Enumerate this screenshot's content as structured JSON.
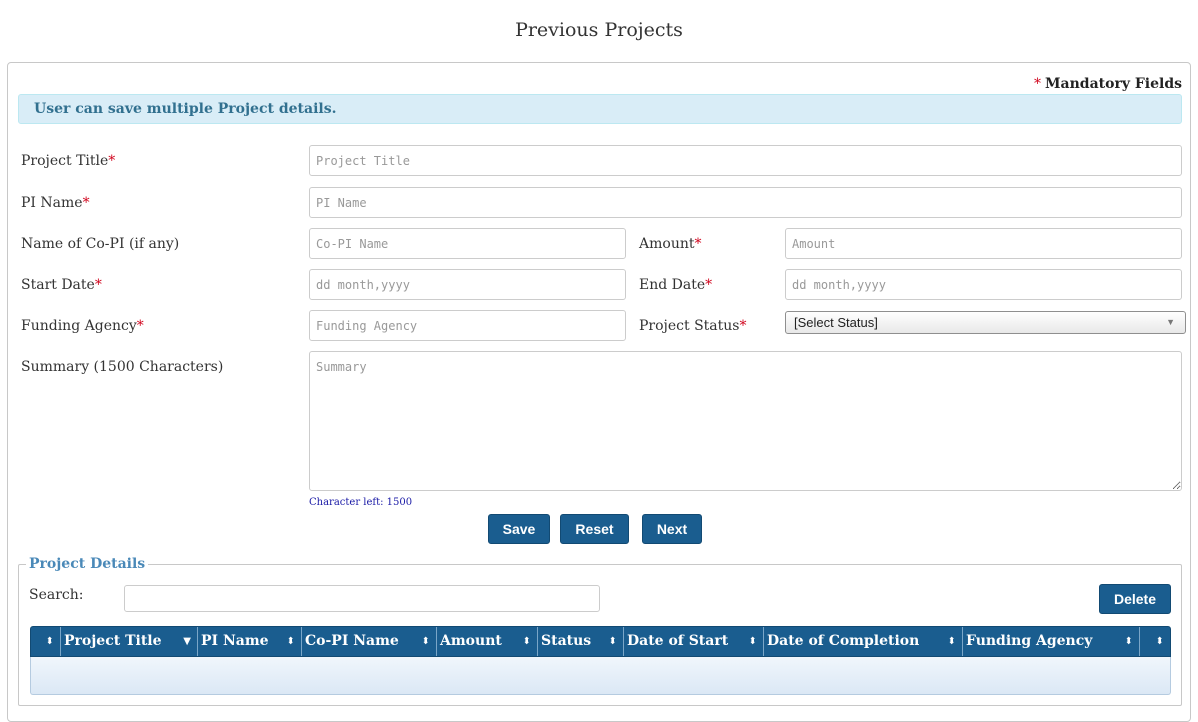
{
  "page": {
    "title": "Previous Projects"
  },
  "form": {
    "mandatory_label": "Mandatory Fields",
    "info_message": "User can save multiple Project details.",
    "fields": {
      "project_title": {
        "label": "Project Title",
        "placeholder": "Project Title"
      },
      "pi_name": {
        "label": "PI Name",
        "placeholder": "PI Name"
      },
      "co_pi": {
        "label": "Name of Co-PI (if any)",
        "placeholder": "Co-PI Name"
      },
      "amount": {
        "label": "Amount",
        "placeholder": "Amount"
      },
      "start_date": {
        "label": "Start Date",
        "placeholder": "dd month,yyyy"
      },
      "end_date": {
        "label": "End Date",
        "placeholder": "dd month,yyyy"
      },
      "funding_agency": {
        "label": "Funding Agency",
        "placeholder": "Funding Agency"
      },
      "project_status": {
        "label": "Project Status",
        "value": "[Select Status]"
      },
      "summary": {
        "label": "Summary (1500 Characters)",
        "placeholder": "Summary"
      }
    },
    "char_left": "Character left: 1500",
    "required_mark": "*",
    "buttons": {
      "save": "Save",
      "reset": "Reset",
      "next": "Next"
    }
  },
  "details": {
    "legend": "Project Details",
    "search_label": "Search:",
    "delete_label": "Delete",
    "columns": [
      "Project Title",
      "PI Name",
      "Co-PI Name",
      "Amount",
      "Status",
      "Date of Start",
      "Date of Completion",
      "Funding Agency"
    ],
    "sort_icon_glyph": "⬍",
    "sort_desc_glyph": "▼",
    "rows": []
  },
  "colors": {
    "accent": "#1a5d8f",
    "info_bg": "#d9edf7",
    "info_text": "#31708f",
    "required": "#d0021b"
  }
}
